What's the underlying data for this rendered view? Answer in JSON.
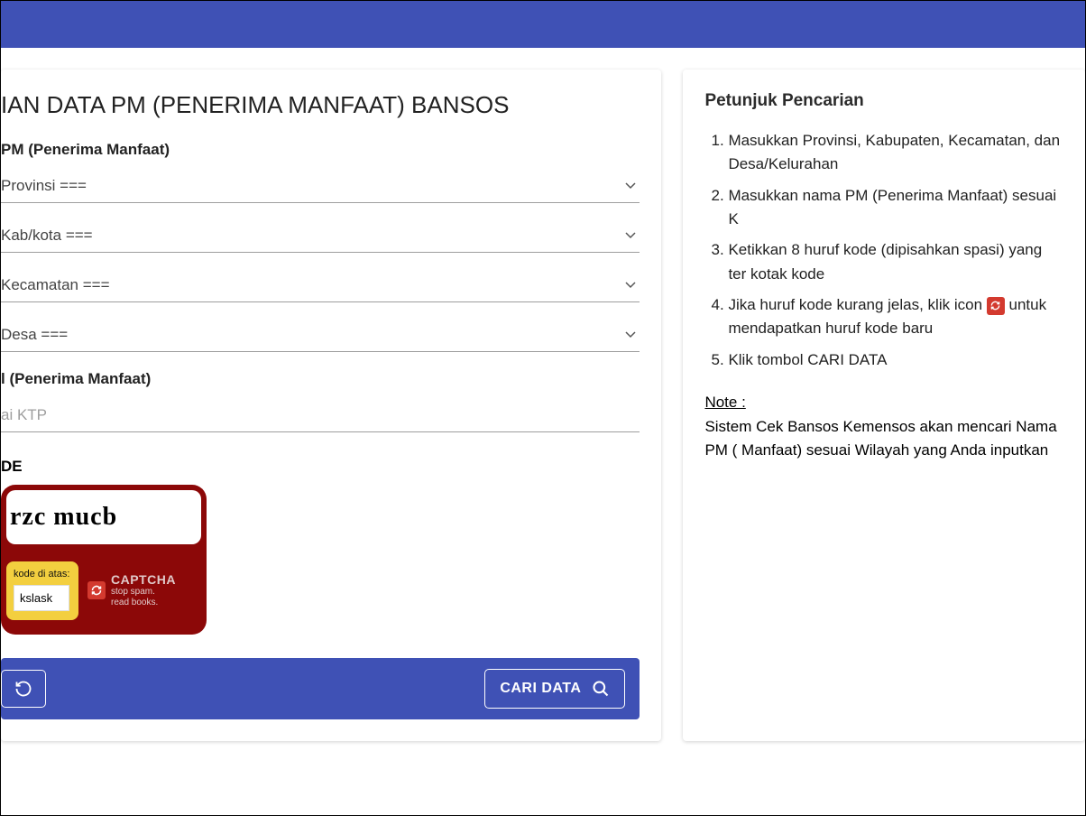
{
  "page_title": "IAN DATA PM (PENERIMA MANFAAT) BANSOS",
  "wilayah_label": "PM (Penerima Manfaat)",
  "selects": {
    "provinsi": "Provinsi ===",
    "kabkota": "Kab/kota ===",
    "kecamatan": "Kecamatan ===",
    "desa": "Desa ==="
  },
  "nama_label": "l (Penerima Manfaat)",
  "nama_placeholder": "ai KTP",
  "kode_label": "DE",
  "captcha": {
    "image_text": "rzc mucb",
    "hint": "kode di atas:",
    "input_value": "kslask",
    "brand": "CAPTCHA",
    "brand_sub": "stop spam.\nread books."
  },
  "buttons": {
    "search": "CARI DATA"
  },
  "instructions": {
    "title": "Petunjuk Pencarian",
    "items": [
      "Masukkan Provinsi, Kabupaten, Kecamatan, dan Desa/Kelurahan",
      "Masukkan nama PM (Penerima Manfaat) sesuai K",
      "Ketikkan 8 huruf kode (dipisahkan spasi) yang ter kotak kode",
      "Jika huruf kode kurang jelas, klik icon {ICON} untuk mendapatkan huruf kode baru",
      "Klik tombol CARI DATA"
    ],
    "note_label": "Note :",
    "note_body": "Sistem Cek Bansos Kemensos akan mencari Nama PM ( Manfaat) sesuai Wilayah yang Anda inputkan"
  }
}
